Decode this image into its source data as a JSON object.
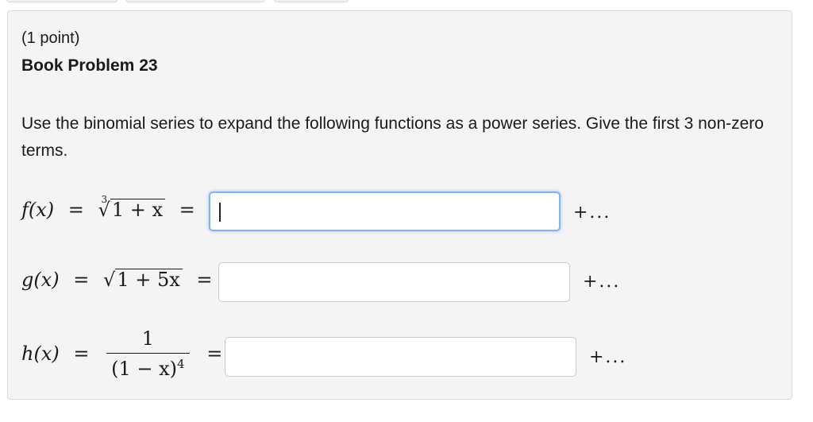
{
  "problem": {
    "points": "(1 point)",
    "title": "Book Problem 23",
    "instructions": "Use the binomial series to expand the following functions as a power series. Give the first 3 non-zero terms."
  },
  "functions": [
    {
      "name": "f(x)",
      "radical_index": "3",
      "radicand": "1 + x",
      "equals": "=",
      "answer_value": "",
      "suffix": "+..."
    },
    {
      "name": "g(x)",
      "radicand": "1 + 5x",
      "equals": "=",
      "answer_value": "",
      "suffix": "+..."
    },
    {
      "name": "h(x)",
      "numerator": "1",
      "denominator": "(1 − x)",
      "exponent": "4",
      "equals": "=",
      "answer_value": "",
      "suffix": "+..."
    }
  ]
}
